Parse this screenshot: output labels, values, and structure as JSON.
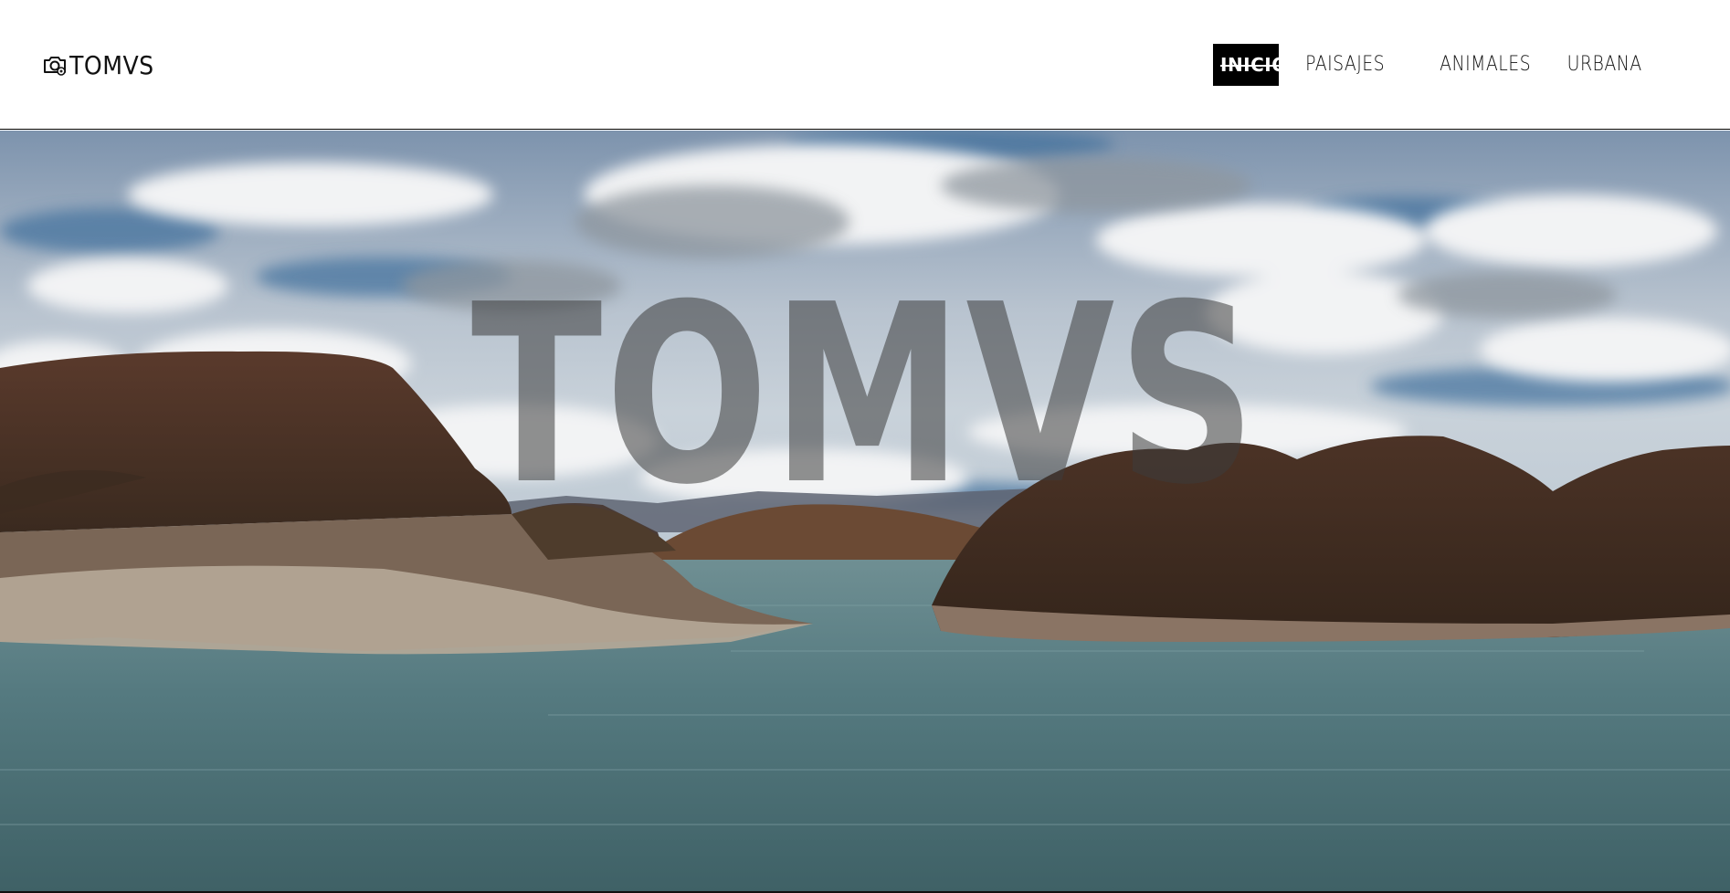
{
  "header": {
    "brand": {
      "icon": "camera-icon",
      "name": "TOMVS"
    },
    "nav": [
      {
        "label": "INICIO",
        "active": true
      },
      {
        "label": "PAISAJES",
        "active": false
      },
      {
        "label": "ANIMALES",
        "active": false
      },
      {
        "label": "URBANA",
        "active": false
      }
    ]
  },
  "hero": {
    "title": "TOMVS",
    "image": "lake-and-mountains-landscape"
  },
  "colors": {
    "header_bg": "#ffffff",
    "active_nav_bg": "#000000",
    "active_nav_text": "#ffffff",
    "text": "#111111",
    "water": "#4f7479",
    "sky": "#a9b9c9"
  }
}
